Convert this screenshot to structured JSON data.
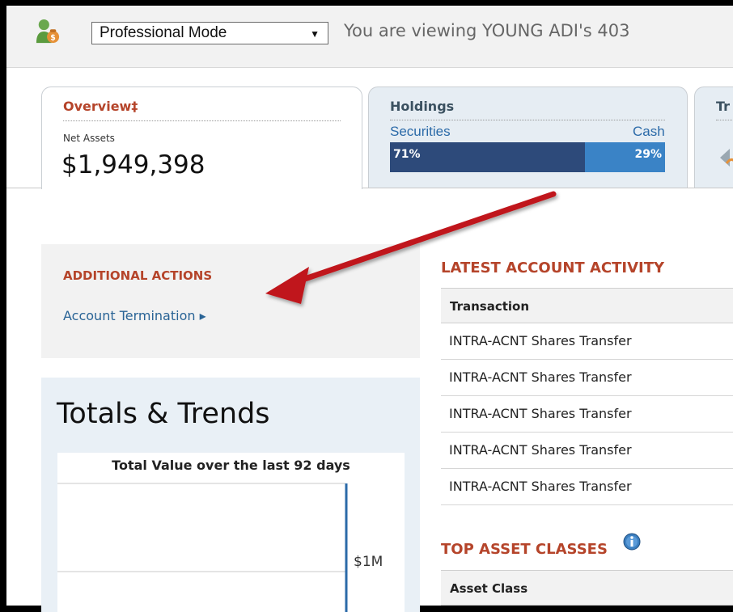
{
  "topbar": {
    "mode_select": "Professional Mode",
    "viewing_text": "You are viewing YOUNG ADI's 403"
  },
  "tabs": {
    "overview": {
      "title": "Overview‡",
      "label": "Net Assets",
      "value": "$1,949,398"
    },
    "holdings": {
      "title": "Holdings",
      "securities_label": "Securities",
      "cash_label": "Cash",
      "securities_pct_text": "71%",
      "cash_pct_text": "29%",
      "securities_fraction": 0.71,
      "cash_fraction": 0.29
    },
    "transactions": {
      "title": "Tr"
    }
  },
  "additional_actions": {
    "title": "ADDITIONAL ACTIONS",
    "link": "Account Termination ▸"
  },
  "totals": {
    "title": "Totals & Trends"
  },
  "chart_data": {
    "type": "line",
    "title": "Total Value over the last 92 days",
    "tick_labels": [
      "$1M"
    ],
    "ylabel": "",
    "xlabel": "",
    "grid": true
  },
  "latest_activity": {
    "title": "LATEST ACCOUNT ACTIVITY",
    "header": "Transaction",
    "rows": [
      "INTRA-ACNT Shares Transfer",
      "INTRA-ACNT Shares Transfer",
      "INTRA-ACNT Shares Transfer",
      "INTRA-ACNT Shares Transfer",
      "INTRA-ACNT Shares Transfer"
    ]
  },
  "top_asset_classes": {
    "title": "TOP ASSET CLASSES",
    "header": "Asset Class"
  },
  "colors": {
    "accent": "#b5442a",
    "link": "#2a6496",
    "securities": "#2d4a7a",
    "cash": "#3a83c6",
    "annotation_arrow": "#c0171b"
  },
  "icons": {
    "user": "user-money-icon",
    "info": "info-icon",
    "transactions": "transactions-icon"
  }
}
